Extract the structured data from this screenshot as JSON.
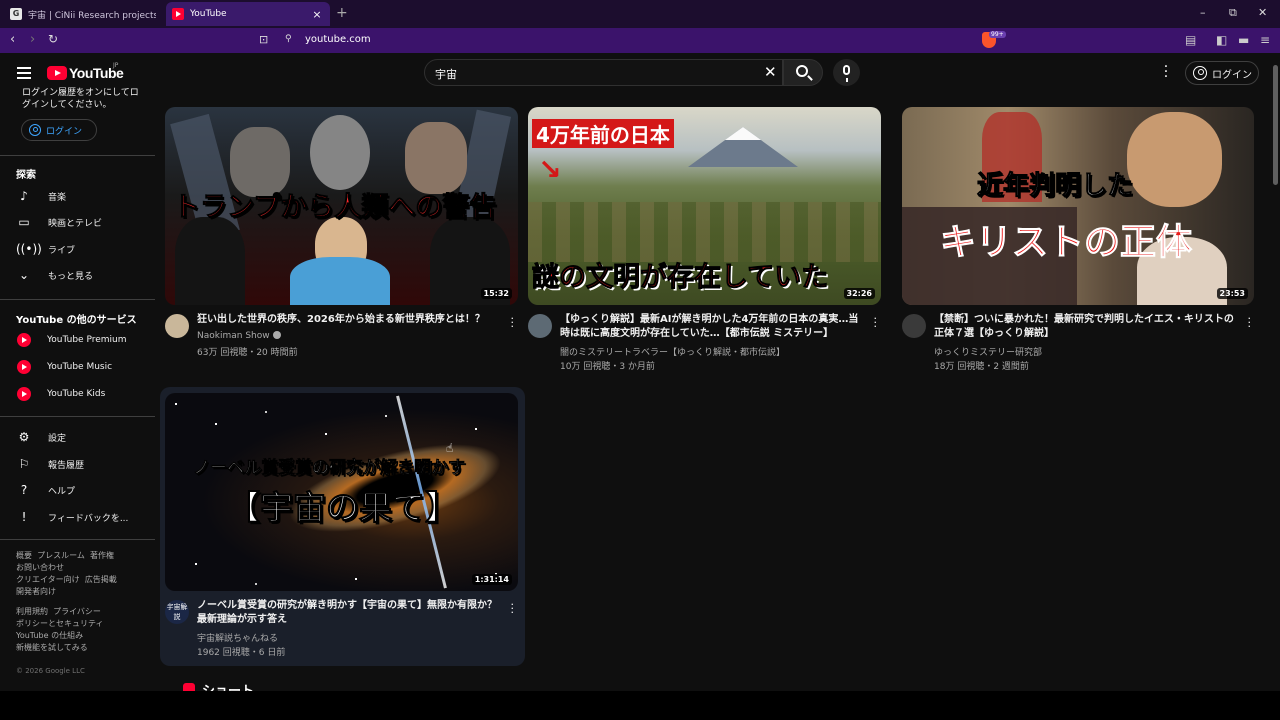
{
  "browser": {
    "tabs": [
      {
        "title": "宇宙 | CiNii Research projects 検索",
        "favicon": "G"
      },
      {
        "title": "YouTube",
        "favicon": "youtube",
        "close": "×"
      }
    ],
    "new_tab": "+",
    "url": "youtube.com",
    "brave_badge": "99+",
    "window_controls": [
      "–",
      "⧉",
      "✕"
    ]
  },
  "header": {
    "logo_text": "YouTube",
    "logo_region": "JP",
    "search_value": "宇宙",
    "login_label": "ログイン"
  },
  "sidebar": {
    "login_note": "ログイン履歴をオンにしてログインしてください。",
    "login_label": "ログイン",
    "explore_heading": "探索",
    "explore_items": [
      {
        "label": "音楽",
        "icon": "music-note-icon"
      },
      {
        "label": "映画とテレビ",
        "icon": "film-icon"
      },
      {
        "label": "ライブ",
        "icon": "live-icon"
      },
      {
        "label": "もっと見る",
        "icon": "chevron-down-icon"
      }
    ],
    "services_heading": "YouTube の他のサービス",
    "services": [
      {
        "label": "YouTube Premium"
      },
      {
        "label": "YouTube Music"
      },
      {
        "label": "YouTube Kids"
      }
    ],
    "settings_items": [
      {
        "label": "設定",
        "icon": "gear-icon"
      },
      {
        "label": "報告履歴",
        "icon": "flag-icon"
      },
      {
        "label": "ヘルプ",
        "icon": "help-icon"
      },
      {
        "label": "フィードバックを...",
        "icon": "feedback-icon"
      }
    ],
    "footer1": [
      "概要",
      "プレスルーム",
      "著作権",
      "お問い合わせ",
      "クリエイター向け",
      "広告掲載",
      "開発者向け"
    ],
    "footer2": [
      "利用規約",
      "プライバシー",
      "ポリシーとセキュリティ",
      "YouTube の仕組み",
      "新機能を試してみる"
    ],
    "copyright": "© 2026 Google LLC"
  },
  "videos": [
    {
      "thumb_text": "トランプから人類への警告",
      "duration": "15:32",
      "title": "狂い出した世界の秩序、2026年から始まる新世界秩序とは！？",
      "channel": "Naokiman Show",
      "meta": "63万 回視聴・20 時間前"
    },
    {
      "thumb_text_top": "4万年前の日本",
      "thumb_text": "謎の文明が存在していた",
      "duration": "32:26",
      "title": "【ゆっくり解説】最新AIが解き明かした4万年前の日本の真実…当時は既に高度文明が存在していた…【都市伝説 ミステリー】",
      "channel": "闇のミステリートラベラー【ゆっくり解説・都市伝説】",
      "meta": "10万 回視聴・3 か月前"
    },
    {
      "thumb_text_top": "近年判明した",
      "thumb_text": "キリストの正体",
      "duration": "23:53",
      "title": "【禁断】ついに暴かれた！最新研究で判明したイエス・キリストの正体７選【ゆっくり解説】",
      "channel": "ゆっくりミステリー研究部",
      "meta": "18万 回視聴・2 週間前"
    },
    {
      "thumb_text_top": "ノーベル賞受賞の研究が解き明かす",
      "thumb_text": "【宇宙の果て】",
      "duration": "1:31:14",
      "title": "ノーベル賞受賞の研究が解き明かす【宇宙の果て】無限か有限か？最新理論が示す答え",
      "channel": "宇宙解説ちゃんねる",
      "channel_avatar_text": "宇宙解説",
      "meta": "1962 回視聴・6 日前"
    }
  ],
  "shorts_heading": "ショート",
  "colors": {
    "accent": "#ff0033",
    "link": "#3ea6ff",
    "bg": "#0f0f0f",
    "browser": "#3b136b"
  }
}
